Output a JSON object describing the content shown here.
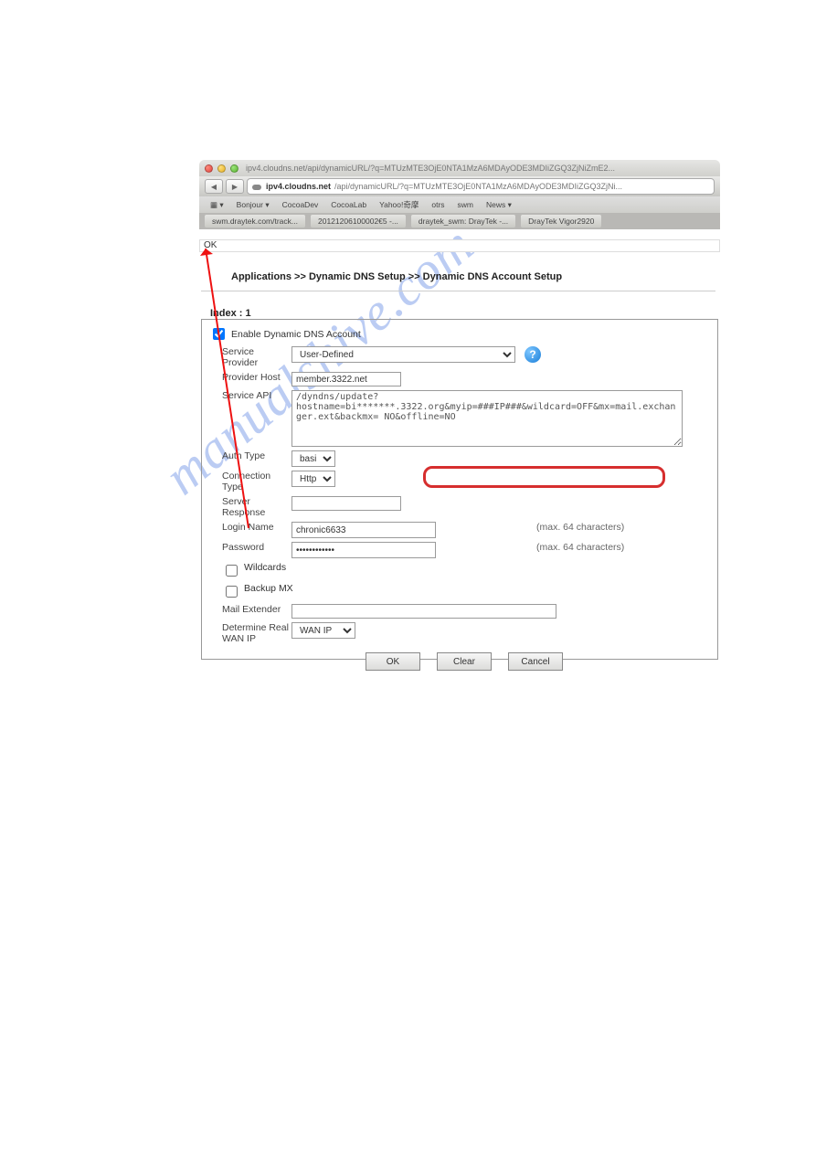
{
  "browser": {
    "title": "ipv4.cloudns.net/api/dynamicURL/?q=MTUzMTE3OjE0NTA1MzA6MDAyODE3MDIiZGQ3ZjNiZmE2...",
    "url_host": "ipv4.cloudns.net",
    "url_path": "/api/dynamicURL/?q=MTUzMTE3OjE0NTA1MzA6MDAyODE3MDIiZGQ3ZjNi...",
    "bookmarks": [
      "Bonjour ▾",
      "CocoaDev",
      "CocoaLab",
      "Yahoo!奇摩",
      "otrs",
      "swm",
      "News ▾"
    ],
    "tabs": [
      "swm.draytek.com/track...",
      "20121206100002€5 -...",
      "draytek_swm: DrayTek -...",
      "DrayTek Vigor2920"
    ],
    "ok_text": "OK"
  },
  "breadcrumb": "Applications >> Dynamic DNS Setup >> Dynamic DNS Account Setup",
  "index_label": "Index : 1",
  "form": {
    "enable_label": "Enable Dynamic DNS Account",
    "service_provider_label": "Service Provider",
    "service_provider_value": "User-Defined",
    "provider_host_label": "Provider Host",
    "provider_host_value": "member.3322.net",
    "service_api_label": "Service API",
    "service_api_value": "/dyndns/update?\nhostname=bi*******.3322.org&myip=###IP###&wildcard=OFF&mx=mail.exchanger.ext&backmx= NO&offline=NO",
    "auth_type_label": "Auth Type",
    "auth_type_value": "basic",
    "connection_type_label": "Connection Type",
    "connection_type_value": "Http",
    "server_response_label": "Server Response",
    "server_response_value": "",
    "login_name_label": "Login Name",
    "login_name_value": "chronic6633",
    "login_hint": "(max. 64 characters)",
    "password_label": "Password",
    "password_value": "••••••••••••",
    "password_hint": "(max. 64 characters)",
    "wildcards_label": "Wildcards",
    "backup_mx_label": "Backup MX",
    "mail_extender_label": "Mail Extender",
    "mail_extender_value": "",
    "determine_wan_label": "Determine Real WAN IP",
    "determine_wan_value": "WAN IP"
  },
  "buttons": {
    "ok": "OK",
    "clear": "Clear",
    "cancel": "Cancel"
  },
  "watermark": "manualshive.com"
}
